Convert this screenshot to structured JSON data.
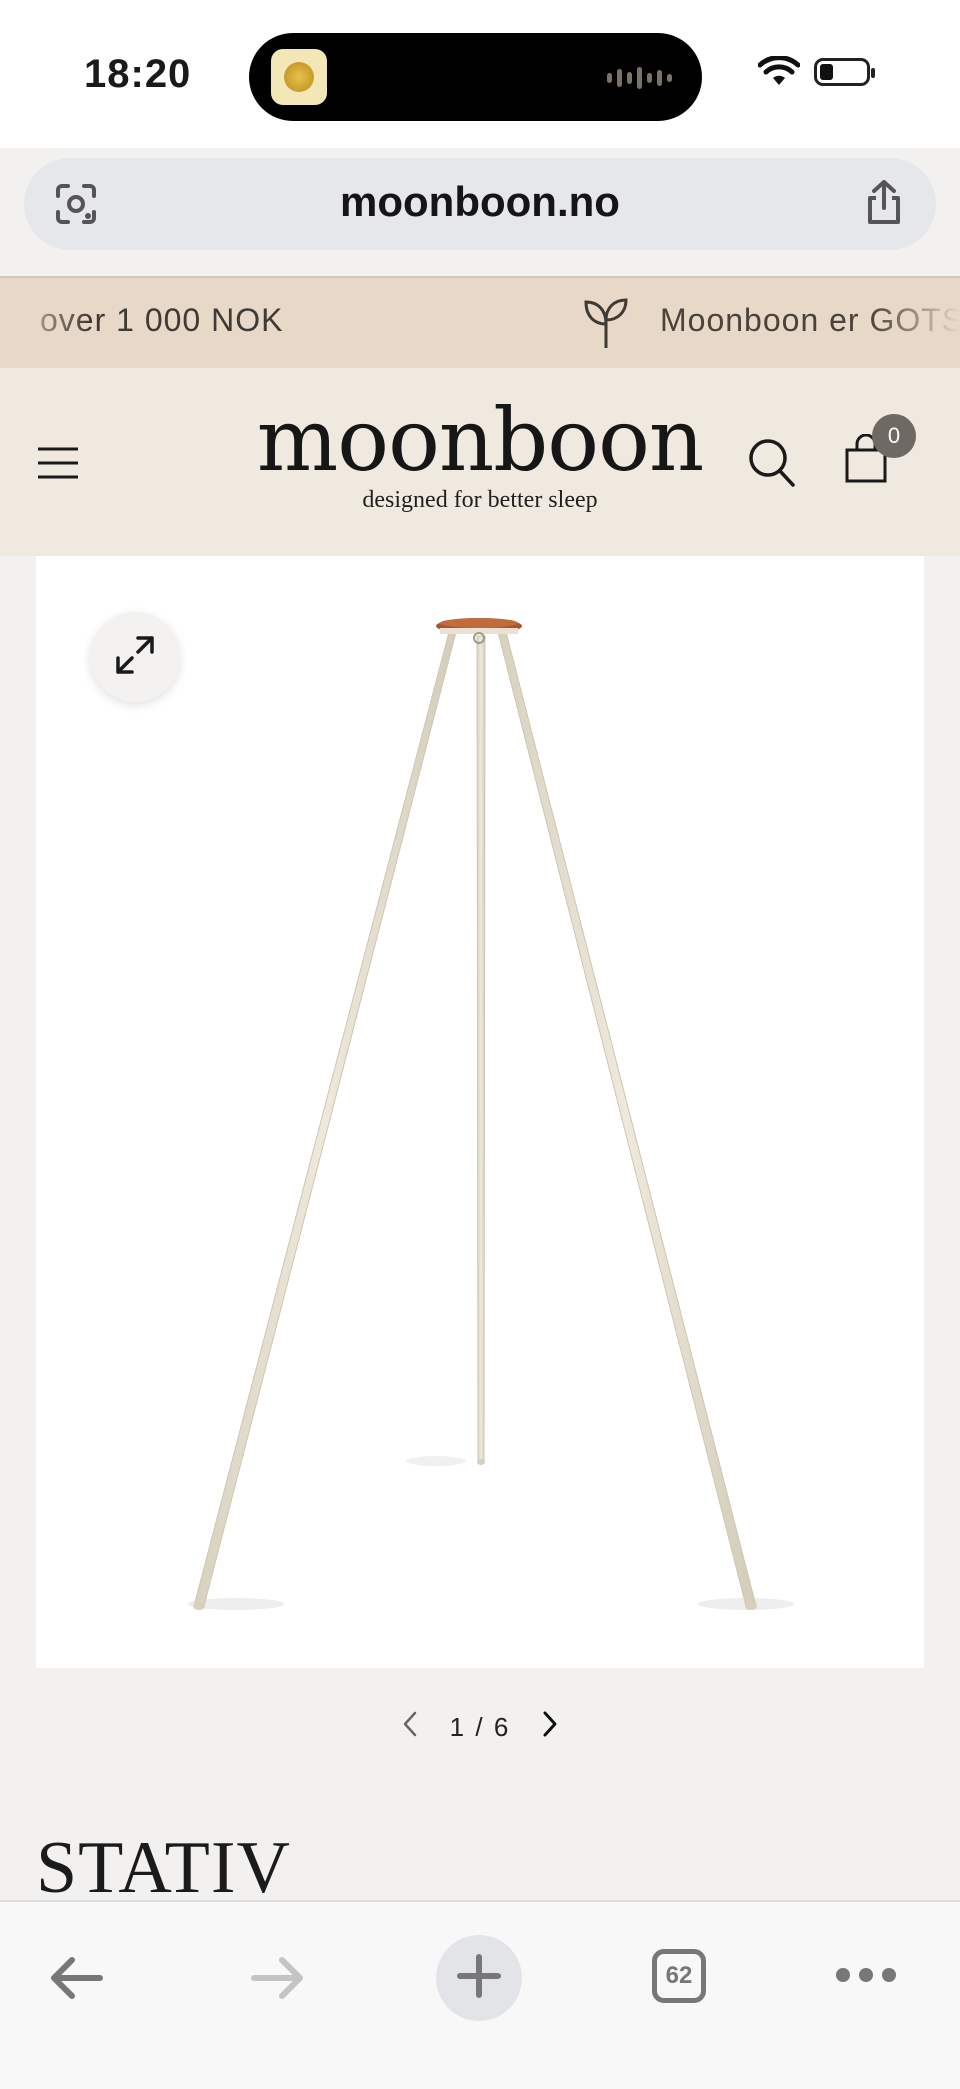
{
  "status_bar": {
    "time": "18:20"
  },
  "browser": {
    "url": "moonboon.no",
    "open_tabs_count": "62"
  },
  "announcement": {
    "message_1": "over 1 000 NOK",
    "message_2": "Moonboon er GOTS"
  },
  "header": {
    "logo_text": "moonboon",
    "tagline": "designed for better sleep",
    "cart_count": "0"
  },
  "gallery": {
    "current": "1",
    "separator": "/",
    "total": "6"
  },
  "product": {
    "title": "STATIV"
  },
  "colors": {
    "announcement_bg": "#e8d8c7",
    "header_bg": "#f0e9df",
    "page_bg": "#f2f1ef",
    "tripod_wood": "#e6dfcf",
    "tripod_top": "#a8552c"
  },
  "icons": {
    "lens": "camera-lens-icon",
    "share": "share-icon",
    "leaf": "leaf-icon",
    "menu": "hamburger-menu-icon",
    "search": "search-icon",
    "cart": "shopping-bag-icon",
    "expand": "expand-icon",
    "prev": "chevron-left-icon",
    "next": "chevron-right-icon",
    "back": "arrow-left-icon",
    "forward": "arrow-right-icon",
    "new_tab": "plus-icon",
    "more": "more-dots-icon"
  }
}
